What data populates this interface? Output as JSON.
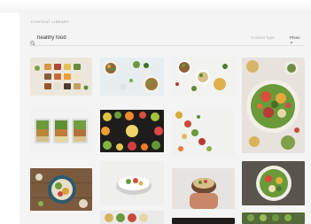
{
  "header": {
    "title": "CONTENT LIBRARY"
  },
  "search": {
    "value": "healthy food",
    "placeholder": ""
  },
  "filters": {
    "content_type_label": "Content Type",
    "type_value": "Photo"
  },
  "icons": [
    "search-icon",
    "chevron-down-icon"
  ],
  "results": [
    {
      "id": "food-photo-1",
      "subject": "healthy food"
    },
    {
      "id": "food-photo-2",
      "subject": "healthy food"
    },
    {
      "id": "food-photo-3",
      "subject": "healthy food"
    },
    {
      "id": "food-photo-4",
      "subject": "healthy food"
    },
    {
      "id": "food-photo-5",
      "subject": "healthy food"
    },
    {
      "id": "food-photo-6",
      "subject": "healthy food"
    },
    {
      "id": "food-photo-7",
      "subject": "healthy food"
    },
    {
      "id": "food-photo-8",
      "subject": "healthy food"
    },
    {
      "id": "food-photo-9",
      "subject": "healthy food"
    },
    {
      "id": "food-photo-10",
      "subject": "healthy food"
    },
    {
      "id": "food-photo-11",
      "subject": "healthy food"
    },
    {
      "id": "food-photo-12",
      "subject": "healthy food"
    }
  ]
}
